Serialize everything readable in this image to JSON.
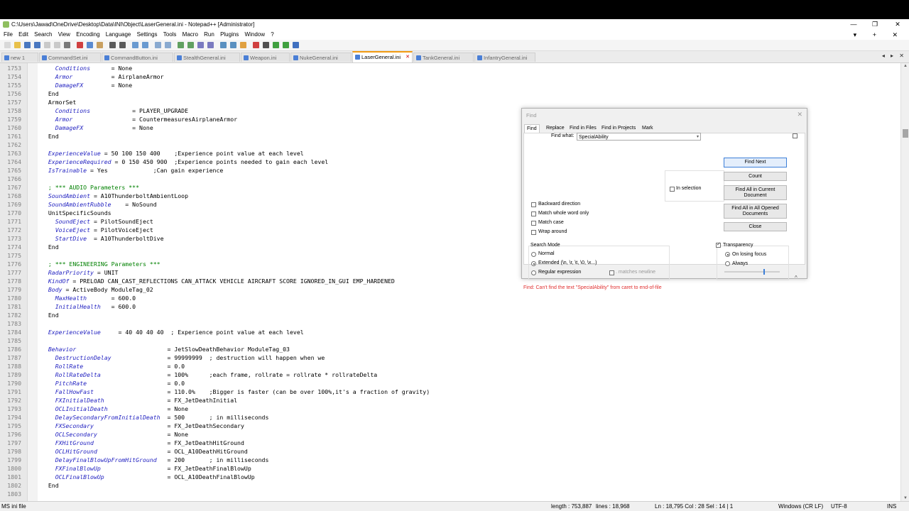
{
  "window": {
    "title": "C:\\Users\\Jawad\\OneDrive\\Desktop\\Data\\INI\\Object\\LaserGeneral.ini - Notepad++ [Administrator]",
    "controls": [
      "—",
      "❐",
      "✕"
    ]
  },
  "menu": {
    "items": [
      "File",
      "Edit",
      "Search",
      "View",
      "Encoding",
      "Language",
      "Settings",
      "Tools",
      "Macro",
      "Run",
      "Plugins",
      "Window",
      "?"
    ],
    "right": "▾ + ✕"
  },
  "tabs": [
    {
      "label": "new 1",
      "active": false
    },
    {
      "label": "CommandSet.ini",
      "active": false
    },
    {
      "label": "CommandButton.ini",
      "active": false
    },
    {
      "label": "StealthGeneral.ini",
      "active": false
    },
    {
      "label": "Weapon.ini",
      "active": false
    },
    {
      "label": "NukeGeneral.ini",
      "active": false
    },
    {
      "label": "LaserGeneral.ini",
      "active": true
    },
    {
      "label": "TankGeneral.ini",
      "active": false
    },
    {
      "label": "InfantryGeneral.ini",
      "active": false
    }
  ],
  "tab_arrows": "◂ ▸ ✕",
  "editor": {
    "lines": [
      {
        "n": "1753",
        "segs": [
          [
            "",
            "    "
          ],
          [
            "k",
            "Conditions"
          ],
          [
            "",
            "      = None"
          ]
        ]
      },
      {
        "n": "1754",
        "segs": [
          [
            "",
            "    "
          ],
          [
            "k",
            "Armor"
          ],
          [
            "",
            "           = AirplaneArmor"
          ]
        ]
      },
      {
        "n": "1755",
        "segs": [
          [
            "",
            "    "
          ],
          [
            "k",
            "DamageFX"
          ],
          [
            "",
            "        = None"
          ]
        ]
      },
      {
        "n": "1756",
        "segs": [
          [
            "",
            "  End"
          ]
        ]
      },
      {
        "n": "1757",
        "segs": [
          [
            "",
            "  ArmorSet"
          ]
        ]
      },
      {
        "n": "1758",
        "segs": [
          [
            "",
            "    "
          ],
          [
            "k",
            "Conditions"
          ],
          [
            "",
            "            = PLAYER_UPGRADE"
          ]
        ]
      },
      {
        "n": "1759",
        "segs": [
          [
            "",
            "    "
          ],
          [
            "k",
            "Armor"
          ],
          [
            "",
            "                 = CountermeasuresAirplaneArmor"
          ]
        ]
      },
      {
        "n": "1760",
        "segs": [
          [
            "",
            "    "
          ],
          [
            "k",
            "DamageFX"
          ],
          [
            "",
            "              = None"
          ]
        ]
      },
      {
        "n": "1761",
        "segs": [
          [
            "",
            "  End"
          ]
        ]
      },
      {
        "n": "1762",
        "segs": [
          [
            "",
            ""
          ]
        ]
      },
      {
        "n": "1763",
        "segs": [
          [
            "",
            "  "
          ],
          [
            "k",
            "ExperienceValue"
          ],
          [
            "",
            " = 50 100 150 400    ;Experience point value at each level"
          ]
        ]
      },
      {
        "n": "1764",
        "segs": [
          [
            "",
            "  "
          ],
          [
            "k",
            "ExperienceRequired"
          ],
          [
            "",
            " = 0 150 450 900  ;Experience points needed to gain each level"
          ]
        ]
      },
      {
        "n": "1765",
        "segs": [
          [
            "",
            "  "
          ],
          [
            "k",
            "IsTrainable"
          ],
          [
            "",
            " = Yes             ;Can gain experience"
          ]
        ]
      },
      {
        "n": "1766",
        "segs": [
          [
            "",
            ""
          ]
        ]
      },
      {
        "n": "1767",
        "segs": [
          [
            "",
            "  "
          ],
          [
            "c",
            "; *** AUDIO Parameters ***"
          ]
        ]
      },
      {
        "n": "1768",
        "segs": [
          [
            "",
            "  "
          ],
          [
            "k",
            "SoundAmbient"
          ],
          [
            "",
            " = A10ThunderboltAmbientLoop"
          ]
        ]
      },
      {
        "n": "1769",
        "segs": [
          [
            "",
            "  "
          ],
          [
            "k",
            "SoundAmbientRubble"
          ],
          [
            "",
            "    = NoSound"
          ]
        ]
      },
      {
        "n": "1770",
        "segs": [
          [
            "",
            "  UnitSpecificSounds"
          ]
        ]
      },
      {
        "n": "1771",
        "segs": [
          [
            "",
            "    "
          ],
          [
            "k",
            "SoundEject"
          ],
          [
            "",
            " = PilotSoundEject"
          ]
        ]
      },
      {
        "n": "1772",
        "segs": [
          [
            "",
            "    "
          ],
          [
            "k",
            "VoiceEject"
          ],
          [
            "",
            " = PilotVoiceEject"
          ]
        ]
      },
      {
        "n": "1773",
        "segs": [
          [
            "",
            "    "
          ],
          [
            "k",
            "StartDive"
          ],
          [
            "",
            "  = A10ThunderboltDive"
          ]
        ]
      },
      {
        "n": "1774",
        "segs": [
          [
            "",
            "  End"
          ]
        ]
      },
      {
        "n": "1775",
        "segs": [
          [
            "",
            ""
          ]
        ]
      },
      {
        "n": "1776",
        "segs": [
          [
            "",
            "  "
          ],
          [
            "c",
            "; *** ENGINEERING Parameters ***"
          ]
        ]
      },
      {
        "n": "1777",
        "segs": [
          [
            "",
            "  "
          ],
          [
            "k",
            "RadarPriority"
          ],
          [
            "",
            " = UNIT"
          ]
        ]
      },
      {
        "n": "1778",
        "segs": [
          [
            "",
            "  "
          ],
          [
            "k",
            "KindOf"
          ],
          [
            "",
            " = PRELOAD CAN_CAST_REFLECTIONS CAN_ATTACK VEHICLE AIRCRAFT SCORE IGNORED_IN_GUI EMP_HARDENED"
          ]
        ]
      },
      {
        "n": "1779",
        "segs": [
          [
            "",
            "  "
          ],
          [
            "k",
            "Body"
          ],
          [
            "",
            " = ActiveBody ModuleTag_02"
          ]
        ]
      },
      {
        "n": "1780",
        "segs": [
          [
            "",
            "    "
          ],
          [
            "k",
            "MaxHealth"
          ],
          [
            "",
            "       = 600.0"
          ]
        ]
      },
      {
        "n": "1781",
        "segs": [
          [
            "",
            "    "
          ],
          [
            "k",
            "InitialHealth"
          ],
          [
            "",
            "   = 600.0"
          ]
        ]
      },
      {
        "n": "1782",
        "segs": [
          [
            "",
            "  End"
          ]
        ]
      },
      {
        "n": "1783",
        "segs": [
          [
            "",
            ""
          ]
        ]
      },
      {
        "n": "1784",
        "segs": [
          [
            "",
            "  "
          ],
          [
            "k",
            "ExperienceValue"
          ],
          [
            "",
            "     = 40 40 40 40  ; Experience point value at each level"
          ]
        ]
      },
      {
        "n": "1785",
        "segs": [
          [
            "",
            ""
          ]
        ]
      },
      {
        "n": "1786",
        "segs": [
          [
            "",
            "  "
          ],
          [
            "k",
            "Behavior"
          ],
          [
            "",
            "                          = JetSlowDeathBehavior ModuleTag_03"
          ]
        ]
      },
      {
        "n": "1787",
        "segs": [
          [
            "",
            "    "
          ],
          [
            "k",
            "DestructionDelay"
          ],
          [
            "",
            "                = 99999999  ; destruction will happen when we"
          ]
        ]
      },
      {
        "n": "1788",
        "segs": [
          [
            "",
            "    "
          ],
          [
            "k",
            "RollRate"
          ],
          [
            "",
            "                        = 0.0"
          ]
        ]
      },
      {
        "n": "1789",
        "segs": [
          [
            "",
            "    "
          ],
          [
            "k",
            "RollRateDelta"
          ],
          [
            "",
            "                   = 100%      ;each frame, rollrate = rollrate * rollrateDelta"
          ]
        ]
      },
      {
        "n": "1790",
        "segs": [
          [
            "",
            "    "
          ],
          [
            "k",
            "PitchRate"
          ],
          [
            "",
            "                       = 0.0"
          ]
        ]
      },
      {
        "n": "1791",
        "segs": [
          [
            "",
            "    "
          ],
          [
            "k",
            "FallHowFast"
          ],
          [
            "",
            "                     = 110.0%    ;Bigger is faster (can be over 100%,it's a fraction of gravity)"
          ]
        ]
      },
      {
        "n": "1792",
        "segs": [
          [
            "",
            "    "
          ],
          [
            "k",
            "FXInitialDeath"
          ],
          [
            "",
            "                  = FX_JetDeathInitial"
          ]
        ]
      },
      {
        "n": "1793",
        "segs": [
          [
            "",
            "    "
          ],
          [
            "k",
            "OCLInitialDeath"
          ],
          [
            "",
            "                 = None"
          ]
        ]
      },
      {
        "n": "1794",
        "segs": [
          [
            "",
            "    "
          ],
          [
            "k",
            "DelaySecondaryFromInitialDeath"
          ],
          [
            "",
            "  = 500       ; in milliseconds"
          ]
        ]
      },
      {
        "n": "1795",
        "segs": [
          [
            "",
            "    "
          ],
          [
            "k",
            "FXSecondary"
          ],
          [
            "",
            "                     = FX_JetDeathSecondary"
          ]
        ]
      },
      {
        "n": "1796",
        "segs": [
          [
            "",
            "    "
          ],
          [
            "k",
            "OCLSecondary"
          ],
          [
            "",
            "                    = None"
          ]
        ]
      },
      {
        "n": "1797",
        "segs": [
          [
            "",
            "    "
          ],
          [
            "k",
            "FXHitGround"
          ],
          [
            "",
            "                     = FX_JetDeathHitGround"
          ]
        ]
      },
      {
        "n": "1798",
        "segs": [
          [
            "",
            "    "
          ],
          [
            "k",
            "OCLHitGround"
          ],
          [
            "",
            "                    = OCL_A10DeathHitGround"
          ]
        ]
      },
      {
        "n": "1799",
        "segs": [
          [
            "",
            "    "
          ],
          [
            "k",
            "DelayFinalBlowUpFromHitGround"
          ],
          [
            "",
            "   = 200       ; in milliseconds"
          ]
        ]
      },
      {
        "n": "1800",
        "segs": [
          [
            "",
            "    "
          ],
          [
            "k",
            "FXFinalBlowUp"
          ],
          [
            "",
            "                   = FX_JetDeathFinalBlowUp"
          ]
        ]
      },
      {
        "n": "1801",
        "segs": [
          [
            "",
            "    "
          ],
          [
            "k",
            "OCLFinalBlowUp"
          ],
          [
            "",
            "                  = OCL_A10DeathFinalBlowUp"
          ]
        ]
      },
      {
        "n": "1802",
        "segs": [
          [
            "",
            "  End"
          ]
        ]
      },
      {
        "n": "1803",
        "segs": [
          [
            "",
            ""
          ]
        ]
      }
    ]
  },
  "find_dialog": {
    "title": "Find",
    "tabs": [
      "Find",
      "Replace",
      "Find in Files",
      "Find in Projects",
      "Mark"
    ],
    "find_what_label": "Find what:",
    "find_what_value": "SpecialAbility",
    "in_selection": "In selection",
    "backward": "Backward direction",
    "whole_word": "Match whole word only",
    "match_case": "Match case",
    "wrap_around": "Wrap around",
    "search_mode_label": "Search Mode",
    "mode_normal": "Normal",
    "mode_extended": "Extended (\\n, \\r, \\t, \\0, \\x...)",
    "mode_regex": "Regular expression",
    "matches_newline": ". matches newline",
    "transparency_label": "Transparency",
    "on_losing_focus": "On losing focus",
    "always": "Always",
    "buttons": {
      "find_next": "Find Next",
      "count": "Count",
      "find_all_current": "Find All in Current Document",
      "find_all_opened": "Find All in All Opened Documents",
      "close": "Close"
    },
    "status": "Find: Can't find the text \"SpecialAbility\" from caret to end-of-file"
  },
  "status_bar": {
    "file_type": "MS ini file",
    "length": "length : 753,887",
    "lines": "lines : 18,968",
    "position": "Ln : 18,795   Col : 28   Sel : 14 | 1",
    "eol": "Windows (CR LF)",
    "encoding": "UTF-8",
    "mode": "INS"
  },
  "colors": {
    "keyword": "#1f1fc0",
    "comment": "#008000",
    "active_tab_accent": "#f39c12",
    "error_text": "#e03030"
  }
}
